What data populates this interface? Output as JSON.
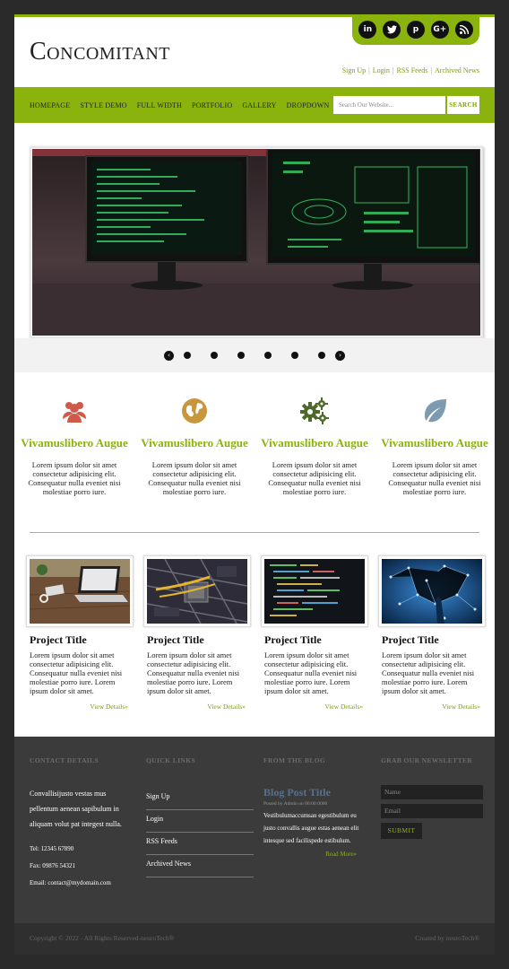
{
  "header": {
    "brand": "Concomitant",
    "social": [
      "in",
      "t",
      "p",
      "G+",
      "rss"
    ],
    "links": [
      "Sign Up",
      "Login",
      "RSS Feeds",
      "Archived News"
    ]
  },
  "nav": {
    "items": [
      "HOMEPAGE",
      "STYLE DEMO",
      "FULL WIDTH",
      "PORTFOLIO",
      "GALLERY",
      "DROPDOWN"
    ],
    "search_placeholder": "Search Our Website...",
    "search_button": "SEARCH"
  },
  "features": [
    {
      "icon": "users-icon",
      "color": "#d05a4a",
      "title": "Vivamuslibero Augue",
      "text": "Lorem ipsum dolor sit amet consectetur adipisicing elit. Consequatur nulla eveniet nisi molestiae porro iure."
    },
    {
      "icon": "globe-icon",
      "color": "#c8963c",
      "title": "Vivamuslibero Augue",
      "text": "Lorem ipsum dolor sit amet consectetur adipisicing elit. Consequatur nulla eveniet nisi molestiae porro iure."
    },
    {
      "icon": "gears-icon",
      "color": "#4e6a2a",
      "title": "Vivamuslibero Augue",
      "text": "Lorem ipsum dolor sit amet consectetur adipisicing elit. Consequatur nulla eveniet nisi molestiae porro iure."
    },
    {
      "icon": "leaf-icon",
      "color": "#7e9aae",
      "title": "Vivamuslibero Augue",
      "text": "Lorem ipsum dolor sit amet consectetur adipisicing elit. Consequatur nulla eveniet nisi molestiae porro iure."
    }
  ],
  "projects": [
    {
      "title": "Project Title",
      "text": "Lorem ipsum dolor sit amet consectetur adipisicing elit. Consequatur nulla eveniet nisi molestiae porro iure. Lorem ipsum dolor sit amet.",
      "more": "View Details"
    },
    {
      "title": "Project Title",
      "text": "Lorem ipsum dolor sit amet consectetur adipisicing elit. Consequatur nulla eveniet nisi molestiae porro iure. Lorem ipsum dolor sit amet.",
      "more": "View Details"
    },
    {
      "title": "Project Title",
      "text": "Lorem ipsum dolor sit amet consectetur adipisicing elit. Consequatur nulla eveniet nisi molestiae porro iure. Lorem ipsum dolor sit amet.",
      "more": "View Details"
    },
    {
      "title": "Project Title",
      "text": "Lorem ipsum dolor sit amet consectetur adipisicing elit. Consequatur nulla eveniet nisi molestiae porro iure. Lorem ipsum dolor sit amet.",
      "more": "View Details"
    }
  ],
  "footer": {
    "contact": {
      "heading": "CONTACT DETAILS",
      "text": "Convallisijusto vestas mus pellentum aenean sapibulum in aliquam volut pat integest nulla.",
      "tel": "Tel:  12345 67890",
      "fax": "Fax:  09876 54321",
      "email": "Email:  contact@mydomain.com"
    },
    "quick_links": {
      "heading": "QUICK LINKS",
      "items": [
        "Sign Up",
        "Login",
        "RSS Feeds",
        "Archived News"
      ]
    },
    "blog": {
      "heading": "FROM THE BLOG",
      "title": "Blog Post Title",
      "meta": "Posted by Admin on 00:00:0000",
      "text": "Vestibulumaccumsan egestibulum eu justo convallis augue estas aenean elit intesque sed facilispede estibulum.",
      "more": "Read More"
    },
    "newsletter": {
      "heading": "GRAB OUR NEWSLETTER",
      "name_placeholder": "Name",
      "email_placeholder": "Email",
      "button": "SUBMIT"
    }
  },
  "bottom": {
    "copyright": "Copyright © 2022 - All Rights Reserved-neuroTech®",
    "created": "Created by neuroTech®"
  },
  "colors": {
    "accent": "#8bb30d",
    "footer_bg": "#3b3b3b"
  }
}
